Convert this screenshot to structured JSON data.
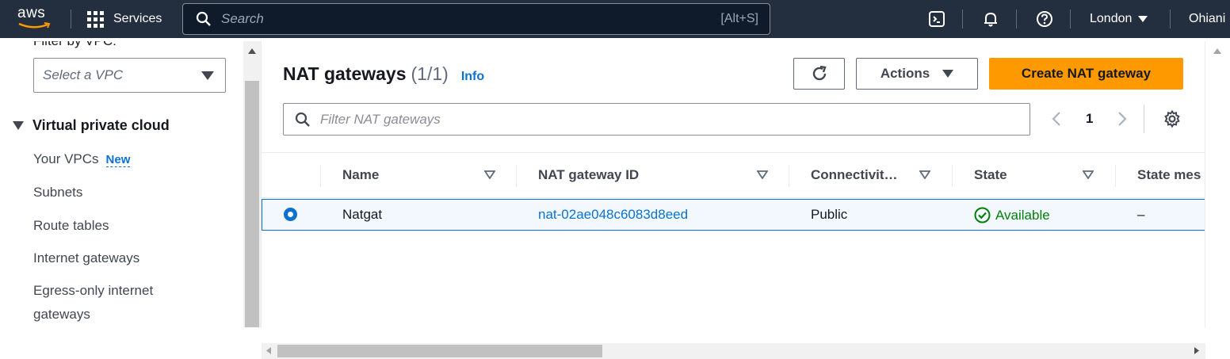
{
  "topnav": {
    "logo_text": "aws",
    "services_label": "Services",
    "search_placeholder": "Search",
    "search_shortcut": "[Alt+S]",
    "region_label": "London",
    "user_label": "Ohiani",
    "icons": [
      "cloudshell-icon",
      "bell-icon",
      "help-icon"
    ]
  },
  "sidebar": {
    "filter_label": "Filter by VPC:",
    "vpc_select_placeholder": "Select a VPC",
    "section_title": "Virtual private cloud",
    "items": [
      {
        "label": "Your VPCs",
        "badge": "New"
      },
      {
        "label": "Subnets"
      },
      {
        "label": "Route tables"
      },
      {
        "label": "Internet gateways"
      },
      {
        "label": "Egress-only internet"
      },
      {
        "label": "gateways"
      }
    ]
  },
  "main": {
    "title": "NAT gateways",
    "count": "(1/1)",
    "info_label": "Info",
    "actions_label": "Actions",
    "create_label": "Create NAT gateway",
    "filter_placeholder": "Filter NAT gateways",
    "page_number": "1",
    "columns": [
      "Name",
      "NAT gateway ID",
      "Connectivit…",
      "State",
      "State mes"
    ],
    "rows": [
      {
        "selected": true,
        "name": "Natgat",
        "nat_gateway_id": "nat-02ae048c6083d8eed",
        "connectivity": "Public",
        "state": "Available",
        "state_message": "–"
      }
    ]
  },
  "colors": {
    "nav_bg": "#232f3e",
    "accent_blue": "#0972d3",
    "primary_orange": "#ff9900",
    "success_green": "#037f0c"
  }
}
